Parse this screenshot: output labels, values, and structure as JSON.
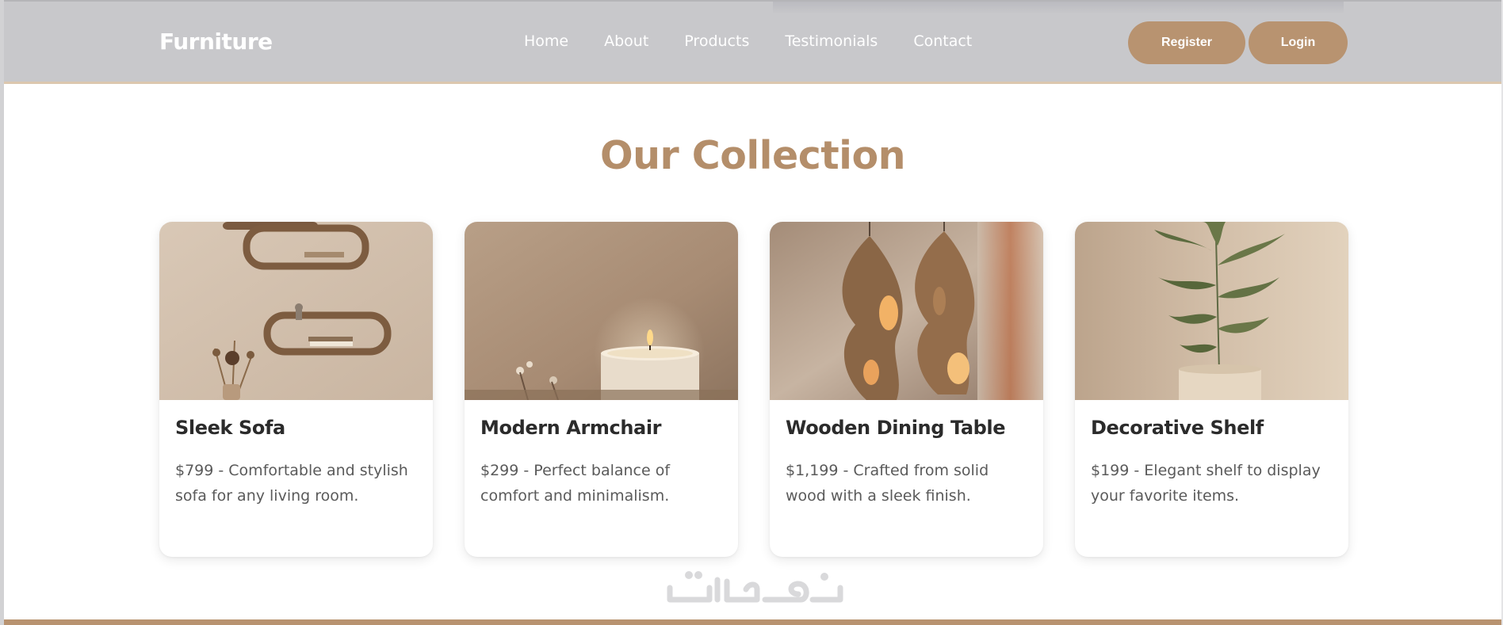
{
  "navbar": {
    "brand": "Furniture",
    "links": [
      {
        "label": "Home"
      },
      {
        "label": "About"
      },
      {
        "label": "Products"
      },
      {
        "label": "Testimonials"
      },
      {
        "label": "Contact"
      }
    ],
    "register_label": "Register",
    "login_label": "Login"
  },
  "collection": {
    "title": "Our Collection",
    "cards": [
      {
        "name": "Sleek Sofa",
        "description": "$799 - Comfortable and stylish sofa for any living room."
      },
      {
        "name": "Modern Armchair",
        "description": "$299 - Perfect balance of comfort and minimalism."
      },
      {
        "name": "Wooden Dining Table",
        "description": "$1,199 - Crafted from solid wood with a sleek finish."
      },
      {
        "name": "Decorative Shelf",
        "description": "$199 - Elegant shelf to display your favorite items."
      }
    ]
  },
  "watermark": {
    "text": "خمسات"
  },
  "colors": {
    "accent": "#b89370",
    "title": "#b48e6a",
    "navbar": "#c8c8cb",
    "text_dark": "#2b2b2b",
    "text_muted": "#5a5a5a"
  },
  "icons": [
    "wall-shelves-image",
    "candle-image",
    "pendant-lamps-image",
    "potted-plant-image"
  ]
}
